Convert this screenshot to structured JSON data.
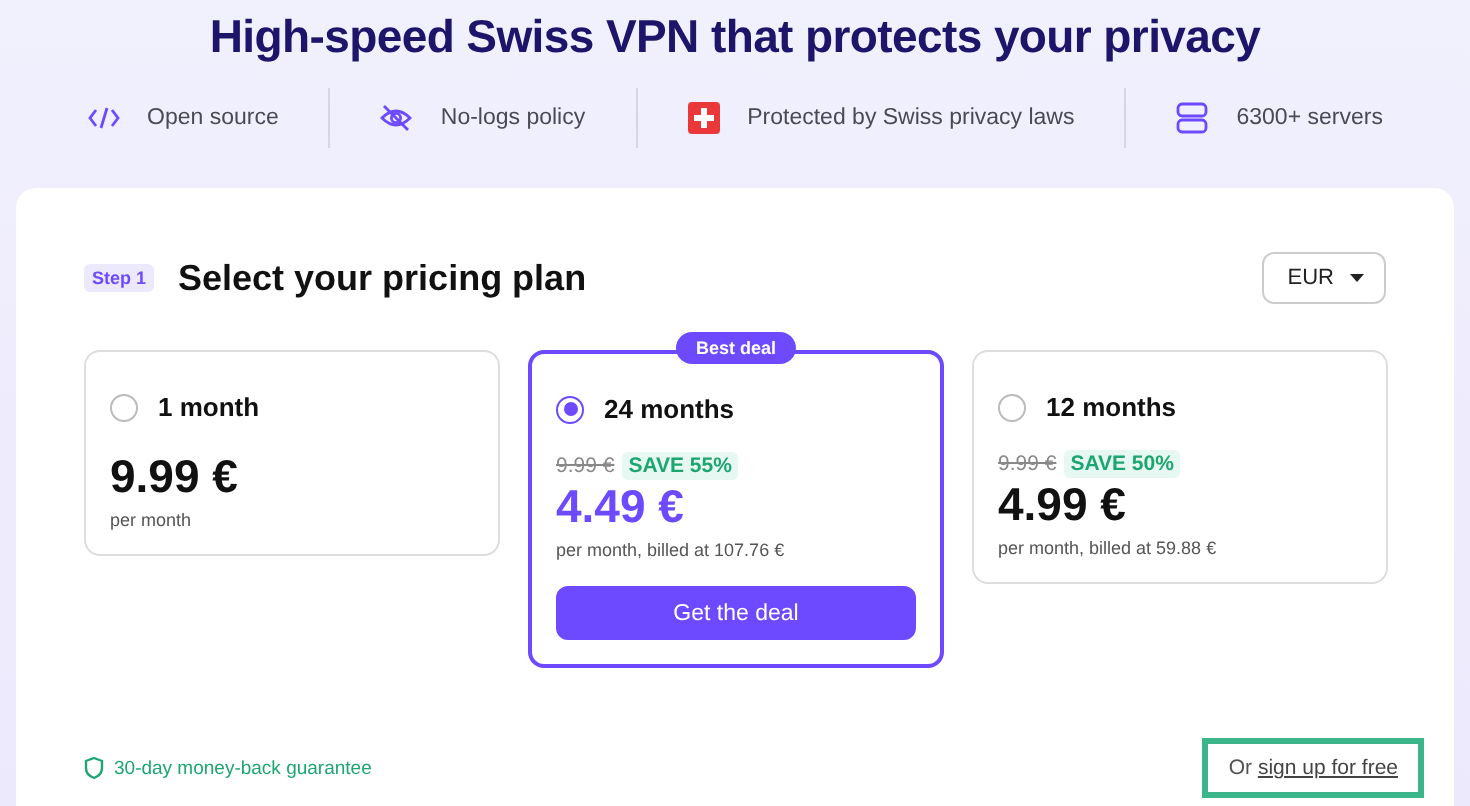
{
  "headline": "High-speed Swiss VPN that protects your privacy",
  "features": [
    {
      "kind": "code",
      "label": "Open source"
    },
    {
      "kind": "eye-off",
      "label": "No-logs policy"
    },
    {
      "kind": "swiss",
      "label": "Protected by Swiss privacy laws"
    },
    {
      "kind": "servers",
      "label": "6300+ servers"
    }
  ],
  "step": {
    "badge": "Step 1",
    "title": "Select your pricing plan"
  },
  "currency": "EUR",
  "plans": [
    {
      "label": "1 month",
      "selected": false,
      "price": "9.99 €",
      "note": "per month"
    },
    {
      "label": "24 months",
      "selected": true,
      "badge": "Best deal",
      "old_price": "9.99 €",
      "save": "SAVE 55%",
      "price": "4.49 €",
      "note": "per month, billed at 107.76 €",
      "button": "Get the deal"
    },
    {
      "label": "12 months",
      "selected": false,
      "old_price": "9.99 €",
      "save": "SAVE 50%",
      "price": "4.99 €",
      "note": "per month, billed at 59.88 €"
    }
  ],
  "guarantee": "30-day money-back guarantee",
  "signup": {
    "prefix": "Or",
    "link": "sign up for free",
    "highlighted": true
  }
}
